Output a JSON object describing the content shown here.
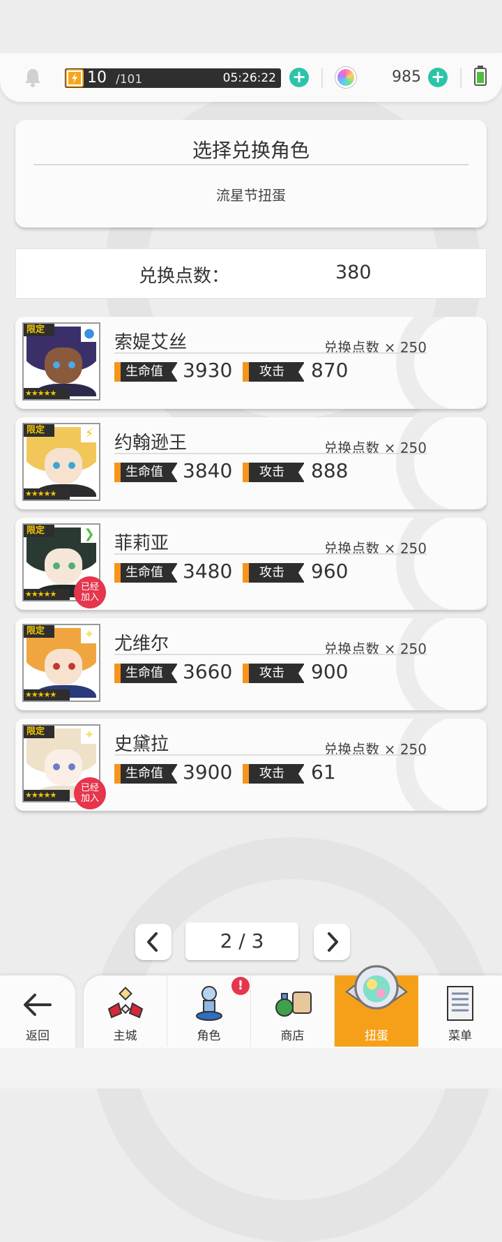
{
  "status": {
    "stamina_current": "10",
    "stamina_max": "/101",
    "stamina_timer": "05:26:22",
    "gems": "985"
  },
  "header": {
    "title": "选择兑换角色",
    "subtitle": "流星节扭蛋"
  },
  "points": {
    "label": "兑换点数：",
    "value": "380"
  },
  "labels": {
    "limited": "限定",
    "hp": "生命值",
    "atk": "攻击",
    "joined_line1": "已经",
    "joined_line2": "加入",
    "stars": "★★★★★"
  },
  "characters": [
    {
      "name": "索媞艾丝",
      "cost": "兑换点数 × 250",
      "hp": "3930",
      "atk": "870",
      "joined": false,
      "element": "water"
    },
    {
      "name": "约翰逊王",
      "cost": "兑换点数 × 250",
      "hp": "3840",
      "atk": "888",
      "joined": false,
      "element": "thunder"
    },
    {
      "name": "菲莉亚",
      "cost": "兑换点数 × 250",
      "hp": "3480",
      "atk": "960",
      "joined": true,
      "element": "wind"
    },
    {
      "name": "尤维尔",
      "cost": "兑换点数 × 250",
      "hp": "3660",
      "atk": "900",
      "joined": false,
      "element": "light"
    },
    {
      "name": "史黛拉",
      "cost": "兑换点数 × 250",
      "hp": "3900",
      "atk": "61",
      "joined": true,
      "element": "light"
    }
  ],
  "pager": {
    "text": "2 / 3"
  },
  "nav": {
    "back": "返回",
    "items": [
      {
        "label": "主城"
      },
      {
        "label": "角色"
      },
      {
        "label": "商店"
      },
      {
        "label": "扭蛋"
      },
      {
        "label": "菜单"
      }
    ],
    "alert": "!"
  }
}
